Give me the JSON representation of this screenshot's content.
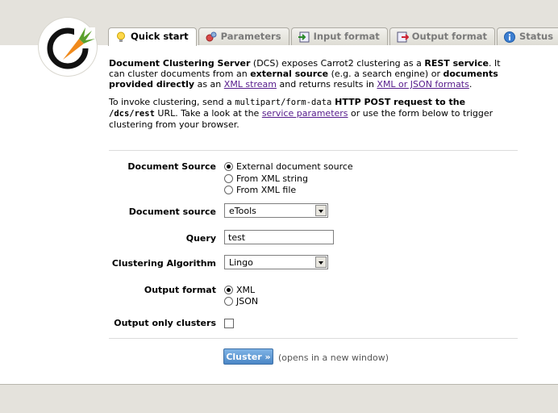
{
  "tabs": [
    {
      "label": "Quick start",
      "icon": "lightbulb-icon",
      "active": true
    },
    {
      "label": "Parameters",
      "icon": "gears-icon",
      "active": false
    },
    {
      "label": "Input format",
      "icon": "input-arrow-icon",
      "active": false
    },
    {
      "label": "Output format",
      "icon": "output-arrow-icon",
      "active": false
    },
    {
      "label": "Status",
      "icon": "info-icon",
      "active": false
    }
  ],
  "intro": {
    "p1": {
      "b1": "Document Clustering Server",
      "t1": " (DCS) exposes Carrot2 clustering as a ",
      "b2": "REST service",
      "t2": ". It can cluster documents from an ",
      "b3": "external source",
      "t3": " (e.g. a search engine) or ",
      "b4": "documents provided directly",
      "t4": " as an ",
      "link1": "XML stream",
      "t5": " and returns results in ",
      "link2": "XML or JSON formats",
      "t6": "."
    },
    "p2": {
      "t1": "To invoke clustering, send a ",
      "code1": "multipart/form-data",
      "b1": " HTTP POST request to the ",
      "code2": "/dcs/rest",
      "t2": " URL. Take a look at the ",
      "link1": "service parameters",
      "t3": " or use the form below to trigger clustering from your browser."
    }
  },
  "form": {
    "doc_source_type": {
      "label": "Document Source",
      "options": [
        "External document source",
        "From XML string",
        "From XML file"
      ],
      "selected": 0
    },
    "doc_source": {
      "label": "Document source",
      "value": "eTools"
    },
    "query": {
      "label": "Query",
      "value": "test"
    },
    "algorithm": {
      "label": "Clustering Algorithm",
      "value": "Lingo"
    },
    "output_format": {
      "label": "Output format",
      "options": [
        "XML",
        "JSON"
      ],
      "selected": 0
    },
    "output_only_clusters": {
      "label": "Output only clusters",
      "checked": false
    },
    "submit_label": "Cluster »",
    "submit_note": "(opens in a new window)"
  },
  "colors": {
    "accent_button": "#4a86c6",
    "link": "#551a8b",
    "logo_orange": "#f08a1c",
    "logo_green": "#5aa02c"
  }
}
